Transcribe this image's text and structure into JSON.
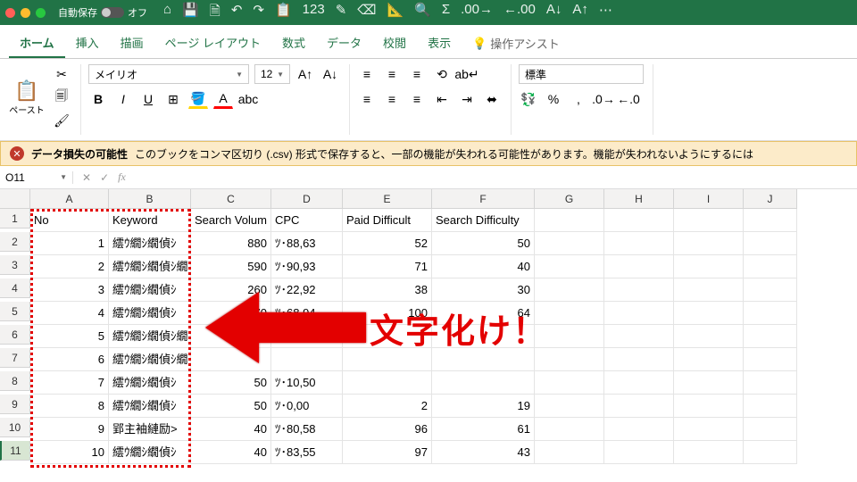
{
  "titlebar": {
    "autosave_label": "自動保存",
    "autosave_state": "オフ",
    "qat_icons": [
      "home",
      "save",
      "saveas",
      "undo",
      "redo",
      "clipboard",
      "number",
      "pen",
      "eraser",
      "ruler",
      "search",
      "fx-sigma",
      "decimal-inc",
      "decimal-dec",
      "sort-az",
      "sort-za",
      "ellipsis"
    ]
  },
  "tabs": [
    "ホーム",
    "挿入",
    "描画",
    "ページ レイアウト",
    "数式",
    "データ",
    "校閲",
    "表示"
  ],
  "tabs_assist": "操作アシスト",
  "ribbon": {
    "paste_label": "ペースト",
    "font_name": "メイリオ",
    "font_size": "12",
    "style_label": "標準"
  },
  "warn": {
    "title": "データ損失の可能性",
    "body": "このブックをコンマ区切り (.csv) 形式で保存すると、一部の機能が失われる可能性があります。機能が失われないようにするには"
  },
  "namebox": "O11",
  "columns": [
    "A",
    "B",
    "C",
    "D",
    "E",
    "F",
    "G",
    "H",
    "I",
    "J"
  ],
  "headers": {
    "A": "No",
    "B": "Keyword",
    "C": "Search Volum",
    "D": "CPC",
    "E": "Paid Difficult",
    "F": "Search Difficulty"
  },
  "rows": [
    {
      "no": "1",
      "kw": "繧ｳ繝ｼ繝偵ｼ",
      "sv": "880",
      "cpc": "ﾂ･88,63",
      "pd": "52",
      "sd": "50"
    },
    {
      "no": "2",
      "kw": "繧ｳ繝ｼ繝偵ｼ繝",
      "sv": "590",
      "cpc": "ﾂ･90,93",
      "pd": "71",
      "sd": "40"
    },
    {
      "no": "3",
      "kw": "繧ｳ繝ｼ繝偵ｼ",
      "sv": "260",
      "cpc": "ﾂ･22,92",
      "pd": "38",
      "sd": "30"
    },
    {
      "no": "4",
      "kw": "繧ｳ繝ｼ繝偵ｼ",
      "sv": "170",
      "cpc": "ﾂ･68,94",
      "pd": "100",
      "sd": "64"
    },
    {
      "no": "5",
      "kw": "繧ｳ繝ｼ繝偵ｼ繝",
      "sv": "",
      "cpc": "",
      "pd": "",
      "sd": ""
    },
    {
      "no": "6",
      "kw": "繧ｳ繝ｼ繝偵ｼ繝",
      "sv": "",
      "cpc": "",
      "pd": "",
      "sd": ""
    },
    {
      "no": "7",
      "kw": "繧ｳ繝ｼ繝偵ｼ",
      "sv": "50",
      "cpc": "ﾂ･10,50",
      "pd": "",
      "sd": ""
    },
    {
      "no": "8",
      "kw": "繧ｳ繝ｼ繝偵ｼ",
      "sv": "50",
      "cpc": "ﾂ･0,00",
      "pd": "2",
      "sd": "19"
    },
    {
      "no": "9",
      "kw": "郢主袖縺励>",
      "sv": "40",
      "cpc": "ﾂ･80,58",
      "pd": "96",
      "sd": "61"
    },
    {
      "no": "10",
      "kw": "繧ｳ繝ｼ繝偵ｼ",
      "sv": "40",
      "cpc": "ﾂ･83,55",
      "pd": "97",
      "sd": "43"
    }
  ],
  "annotation": "文字化け！"
}
